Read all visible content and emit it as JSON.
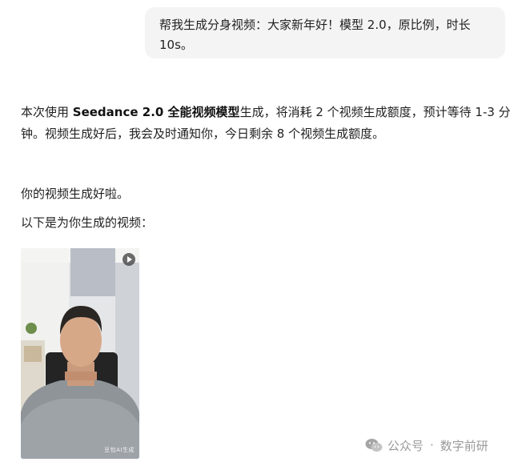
{
  "user_message": {
    "text": "帮我生成分身视频：大家新年好！模型 2.0，原比例，时长 10s。"
  },
  "assistant": {
    "intro_before": "本次使用 ",
    "model_name": "Seedance 2.0 全能视频模型",
    "intro_after": "生成，将消耗 2 个视频生成额度，预计等待 1-3 分钟。视频生成好后，我会及时通知你，今日剩余 8 个视频生成额度。",
    "done_text": "你的视频生成好啦。",
    "video_intro": "以下是为你生成的视频："
  },
  "video": {
    "watermark": "豆包AI生成",
    "play_icon": "play-icon"
  },
  "watermark": {
    "icon": "wechat-icon",
    "account_type": "公众号",
    "separator": "·",
    "account_name": "数字前研"
  }
}
